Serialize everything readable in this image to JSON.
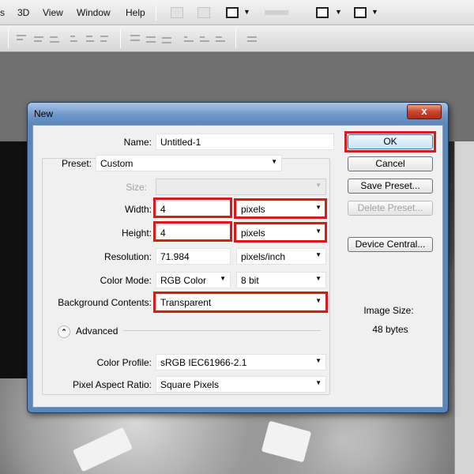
{
  "menu": {
    "items": [
      "s",
      "3D",
      "View",
      "Window",
      "Help"
    ]
  },
  "dialog": {
    "title": "New",
    "close_label": "x",
    "name_label": "Name:",
    "name_value": "Untitled-1",
    "preset_label": "Preset:",
    "preset_value": "Custom",
    "size_label": "Size:",
    "size_value": "",
    "width_label": "Width:",
    "width_value": "4",
    "width_unit": "pixels",
    "height_label": "Height:",
    "height_value": "4",
    "height_unit": "pixels",
    "resolution_label": "Resolution:",
    "resolution_value": "71.984",
    "resolution_unit": "pixels/inch",
    "color_mode_label": "Color Mode:",
    "color_mode_value": "RGB Color",
    "bit_depth_value": "8 bit",
    "background_label": "Background Contents:",
    "background_value": "Transparent",
    "advanced_label": "Advanced",
    "color_profile_label": "Color Profile:",
    "color_profile_value": "sRGB IEC61966-2.1",
    "pixel_aspect_label": "Pixel Aspect Ratio:",
    "pixel_aspect_value": "Square Pixels",
    "buttons": {
      "ok": "OK",
      "cancel": "Cancel",
      "save_preset": "Save Preset...",
      "delete_preset": "Delete Preset...",
      "device_central": "Device Central..."
    },
    "image_size_label": "Image Size:",
    "image_size_value": "48 bytes"
  },
  "colors": {
    "highlight": "#d41c1c",
    "dialog_frame": "#5b86b8",
    "dialog_client": "#f0f0f0"
  }
}
